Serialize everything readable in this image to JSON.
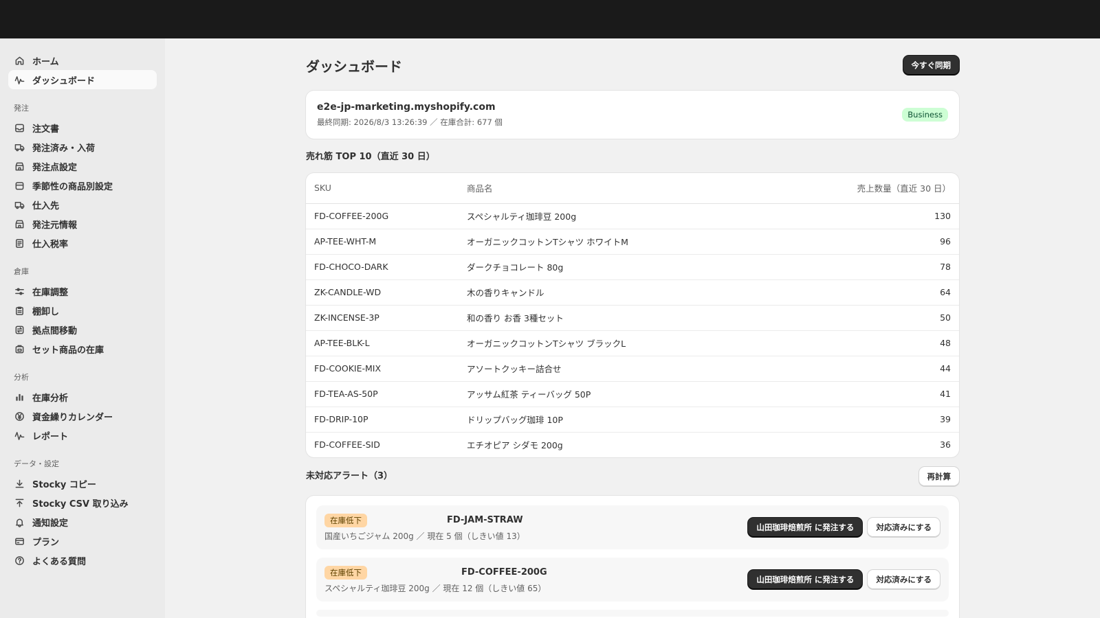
{
  "sidebar": {
    "top_items": [
      {
        "label": "ホーム",
        "icon": "home-icon"
      },
      {
        "label": "ダッシュボード",
        "icon": "activity-icon",
        "active": true
      }
    ],
    "sections": [
      {
        "title": "発注",
        "items": [
          {
            "label": "注文書",
            "icon": "inbox-icon"
          },
          {
            "label": "発注済み・入荷",
            "icon": "truck-icon"
          },
          {
            "label": "発注点設定",
            "icon": "store-icon"
          },
          {
            "label": "季節性の商品別設定",
            "icon": "calendar-icon"
          },
          {
            "label": "仕入先",
            "icon": "truck-icon"
          },
          {
            "label": "発注元情報",
            "icon": "store-icon"
          },
          {
            "label": "仕入税率",
            "icon": "receipt-icon"
          }
        ]
      },
      {
        "title": "倉庫",
        "items": [
          {
            "label": "在庫調整",
            "icon": "sliders-icon"
          },
          {
            "label": "棚卸し",
            "icon": "clipboard-icon"
          },
          {
            "label": "拠点間移動",
            "icon": "transfer-icon"
          },
          {
            "label": "セット商品の在庫",
            "icon": "package-icon"
          }
        ]
      },
      {
        "title": "分析",
        "items": [
          {
            "label": "在庫分析",
            "icon": "bar-chart-icon"
          },
          {
            "label": "資金繰りカレンダー",
            "icon": "yen-icon"
          },
          {
            "label": "レポート",
            "icon": "activity-icon"
          }
        ]
      },
      {
        "title": "データ・設定",
        "items": [
          {
            "label": "Stocky コピー",
            "icon": "download-icon"
          },
          {
            "label": "Stocky CSV 取り込み",
            "icon": "upload-icon"
          },
          {
            "label": "通知設定",
            "icon": "bell-icon"
          },
          {
            "label": "プラン",
            "icon": "credit-card-icon"
          },
          {
            "label": "よくある質問",
            "icon": "help-icon"
          }
        ]
      }
    ]
  },
  "header": {
    "title": "ダッシュボード",
    "sync_button": "今すぐ同期"
  },
  "store": {
    "domain": "e2e-jp-marketing.myshopify.com",
    "meta": "最終同期: 2026/8/3 13:26:39 ／ 在庫合計: 677 個",
    "plan_badge": "Business"
  },
  "top_sellers": {
    "title": "売れ筋 TOP 10（直近 30 日）",
    "columns": {
      "sku": "SKU",
      "name": "商品名",
      "qty": "売上数量（直近 30 日）"
    },
    "rows": [
      {
        "sku": "FD-COFFEE-200G",
        "name": "スペシャルティ珈琲豆 200g",
        "qty": "130"
      },
      {
        "sku": "AP-TEE-WHT-M",
        "name": "オーガニックコットンTシャツ ホワイトM",
        "qty": "96"
      },
      {
        "sku": "FD-CHOCO-DARK",
        "name": "ダークチョコレート 80g",
        "qty": "78"
      },
      {
        "sku": "ZK-CANDLE-WD",
        "name": "木の香りキャンドル",
        "qty": "64"
      },
      {
        "sku": "ZK-INCENSE-3P",
        "name": "和の香り お香 3種セット",
        "qty": "50"
      },
      {
        "sku": "AP-TEE-BLK-L",
        "name": "オーガニックコットンTシャツ ブラックL",
        "qty": "48"
      },
      {
        "sku": "FD-COOKIE-MIX",
        "name": "アソートクッキー詰合せ",
        "qty": "44"
      },
      {
        "sku": "FD-TEA-AS-50P",
        "name": "アッサム紅茶 ティーバッグ 50P",
        "qty": "41"
      },
      {
        "sku": "FD-DRIP-10P",
        "name": "ドリップバッグ珈琲 10P",
        "qty": "39"
      },
      {
        "sku": "FD-COFFEE-SID",
        "name": "エチオピア シダモ 200g",
        "qty": "36"
      }
    ]
  },
  "alerts": {
    "title": "未対応アラート（3）",
    "recalc_button": "再計算",
    "items": [
      {
        "badge": "在庫低下",
        "sku": "FD-JAM-STRAW",
        "desc": "国産いちごジャム 200g ／ 現在 5 個（しきい値 13）",
        "order_button": "山田珈琲焙煎所 に発注する",
        "resolve_button": "対応済みにする"
      },
      {
        "badge": "在庫低下",
        "sku": "FD-COFFEE-200G",
        "desc": "スペシャルティ珈琲豆 200g ／ 現在 12 個（しきい値 65）",
        "order_button": "山田珈琲焙煎所 に発注する",
        "resolve_button": "対応済みにする"
      }
    ]
  },
  "colors": {
    "topbar": "#1a1a1a",
    "sidebar_bg": "#ebebeb",
    "page_bg": "#f1f1f1",
    "badge_green": "#cdfed4",
    "badge_orange": "#ffd6a4",
    "primary_button": "#303030"
  }
}
